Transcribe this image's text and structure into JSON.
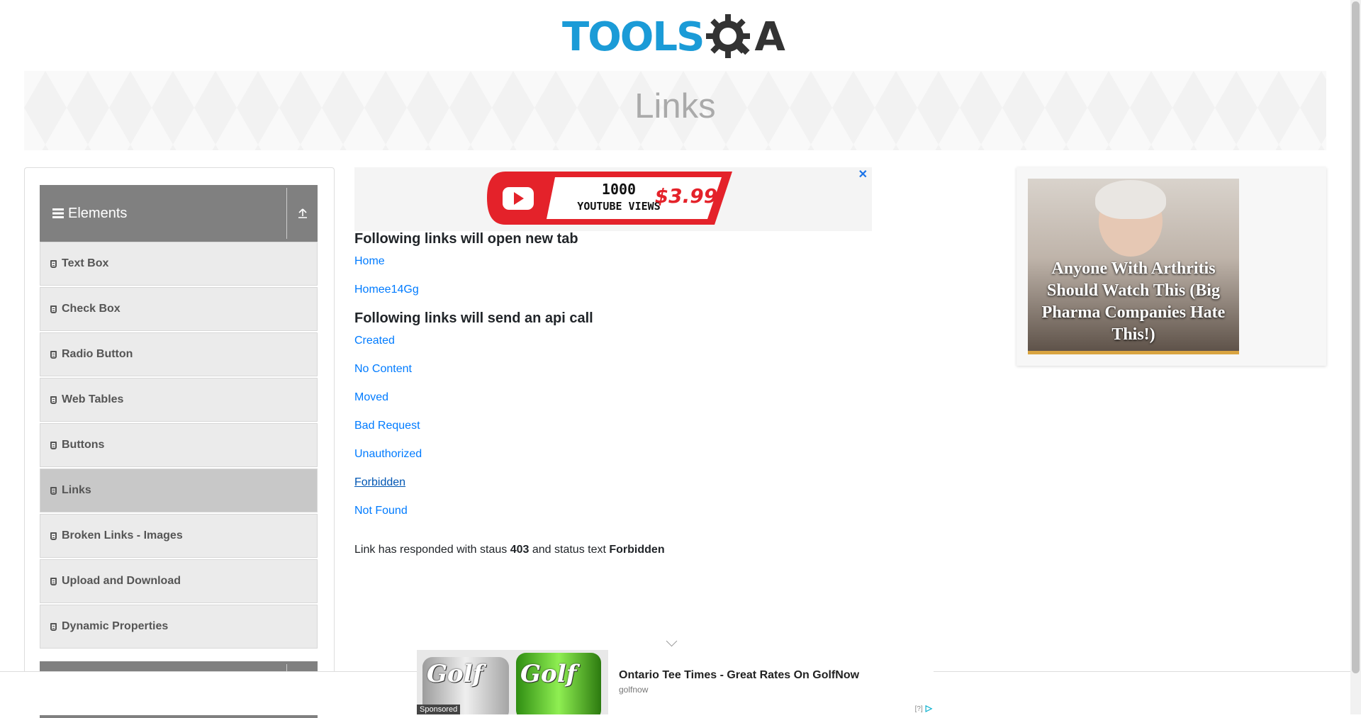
{
  "header": {
    "logo_text": "TOOLS",
    "logo_suffix": "A",
    "logo_color": "#1b9bd7"
  },
  "banner": {
    "title": "Links"
  },
  "sidebar": {
    "group_title": "Elements",
    "group_toggle_icon": "collapse-up-icon",
    "items": [
      {
        "label": "Text Box"
      },
      {
        "label": "Check Box"
      },
      {
        "label": "Radio Button"
      },
      {
        "label": "Web Tables"
      },
      {
        "label": "Buttons"
      },
      {
        "label": "Links",
        "active": true
      },
      {
        "label": "Broken Links - Images"
      },
      {
        "label": "Upload and Download"
      },
      {
        "label": "Dynamic Properties"
      }
    ]
  },
  "main": {
    "ad_top": {
      "text_line1": "1000",
      "text_line2": "YOUTUBE VIEWS",
      "price": "$3.99",
      "close_label": "✕"
    },
    "new_tab_heading": "Following links will open new tab",
    "new_tab_links": [
      "Home",
      "Homee14Gg"
    ],
    "api_heading": "Following links will send an api call",
    "api_links": [
      "Created",
      "No Content",
      "Moved",
      "Bad Request",
      "Unauthorized",
      "Forbidden",
      "Not Found"
    ],
    "hovered_link": "Forbidden",
    "response": {
      "prefix": "Link has responded with staus",
      "status_code": "403",
      "middle": "and status text",
      "status_text": "Forbidden"
    }
  },
  "right_ad": {
    "text": "Anyone With Arthritis Should Watch This (Big Pharma Companies Hate This!)"
  },
  "bottom_ad": {
    "title": "Ontario Tee Times - Great Rates On GolfNow",
    "source": "golfnow",
    "sponsored_label": "Sponsored",
    "can_label": "Golf",
    "ad_choices": "[?]"
  }
}
